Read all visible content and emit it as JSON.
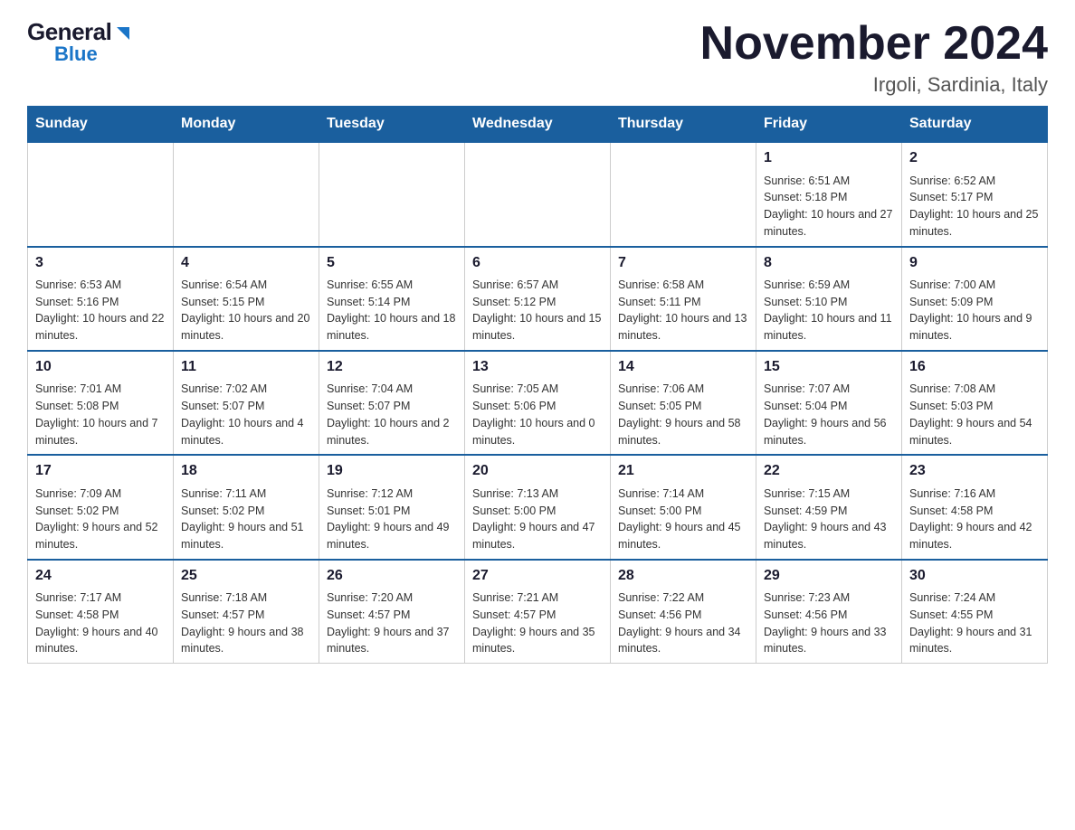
{
  "header": {
    "logo_general": "General",
    "logo_triangle": "▶",
    "logo_blue": "Blue",
    "month_title": "November 2024",
    "location": "Irgoli, Sardinia, Italy"
  },
  "days_of_week": [
    "Sunday",
    "Monday",
    "Tuesday",
    "Wednesday",
    "Thursday",
    "Friday",
    "Saturday"
  ],
  "weeks": [
    {
      "days": [
        {
          "num": "",
          "info": ""
        },
        {
          "num": "",
          "info": ""
        },
        {
          "num": "",
          "info": ""
        },
        {
          "num": "",
          "info": ""
        },
        {
          "num": "",
          "info": ""
        },
        {
          "num": "1",
          "info": "Sunrise: 6:51 AM\nSunset: 5:18 PM\nDaylight: 10 hours and 27 minutes."
        },
        {
          "num": "2",
          "info": "Sunrise: 6:52 AM\nSunset: 5:17 PM\nDaylight: 10 hours and 25 minutes."
        }
      ]
    },
    {
      "days": [
        {
          "num": "3",
          "info": "Sunrise: 6:53 AM\nSunset: 5:16 PM\nDaylight: 10 hours and 22 minutes."
        },
        {
          "num": "4",
          "info": "Sunrise: 6:54 AM\nSunset: 5:15 PM\nDaylight: 10 hours and 20 minutes."
        },
        {
          "num": "5",
          "info": "Sunrise: 6:55 AM\nSunset: 5:14 PM\nDaylight: 10 hours and 18 minutes."
        },
        {
          "num": "6",
          "info": "Sunrise: 6:57 AM\nSunset: 5:12 PM\nDaylight: 10 hours and 15 minutes."
        },
        {
          "num": "7",
          "info": "Sunrise: 6:58 AM\nSunset: 5:11 PM\nDaylight: 10 hours and 13 minutes."
        },
        {
          "num": "8",
          "info": "Sunrise: 6:59 AM\nSunset: 5:10 PM\nDaylight: 10 hours and 11 minutes."
        },
        {
          "num": "9",
          "info": "Sunrise: 7:00 AM\nSunset: 5:09 PM\nDaylight: 10 hours and 9 minutes."
        }
      ]
    },
    {
      "days": [
        {
          "num": "10",
          "info": "Sunrise: 7:01 AM\nSunset: 5:08 PM\nDaylight: 10 hours and 7 minutes."
        },
        {
          "num": "11",
          "info": "Sunrise: 7:02 AM\nSunset: 5:07 PM\nDaylight: 10 hours and 4 minutes."
        },
        {
          "num": "12",
          "info": "Sunrise: 7:04 AM\nSunset: 5:07 PM\nDaylight: 10 hours and 2 minutes."
        },
        {
          "num": "13",
          "info": "Sunrise: 7:05 AM\nSunset: 5:06 PM\nDaylight: 10 hours and 0 minutes."
        },
        {
          "num": "14",
          "info": "Sunrise: 7:06 AM\nSunset: 5:05 PM\nDaylight: 9 hours and 58 minutes."
        },
        {
          "num": "15",
          "info": "Sunrise: 7:07 AM\nSunset: 5:04 PM\nDaylight: 9 hours and 56 minutes."
        },
        {
          "num": "16",
          "info": "Sunrise: 7:08 AM\nSunset: 5:03 PM\nDaylight: 9 hours and 54 minutes."
        }
      ]
    },
    {
      "days": [
        {
          "num": "17",
          "info": "Sunrise: 7:09 AM\nSunset: 5:02 PM\nDaylight: 9 hours and 52 minutes."
        },
        {
          "num": "18",
          "info": "Sunrise: 7:11 AM\nSunset: 5:02 PM\nDaylight: 9 hours and 51 minutes."
        },
        {
          "num": "19",
          "info": "Sunrise: 7:12 AM\nSunset: 5:01 PM\nDaylight: 9 hours and 49 minutes."
        },
        {
          "num": "20",
          "info": "Sunrise: 7:13 AM\nSunset: 5:00 PM\nDaylight: 9 hours and 47 minutes."
        },
        {
          "num": "21",
          "info": "Sunrise: 7:14 AM\nSunset: 5:00 PM\nDaylight: 9 hours and 45 minutes."
        },
        {
          "num": "22",
          "info": "Sunrise: 7:15 AM\nSunset: 4:59 PM\nDaylight: 9 hours and 43 minutes."
        },
        {
          "num": "23",
          "info": "Sunrise: 7:16 AM\nSunset: 4:58 PM\nDaylight: 9 hours and 42 minutes."
        }
      ]
    },
    {
      "days": [
        {
          "num": "24",
          "info": "Sunrise: 7:17 AM\nSunset: 4:58 PM\nDaylight: 9 hours and 40 minutes."
        },
        {
          "num": "25",
          "info": "Sunrise: 7:18 AM\nSunset: 4:57 PM\nDaylight: 9 hours and 38 minutes."
        },
        {
          "num": "26",
          "info": "Sunrise: 7:20 AM\nSunset: 4:57 PM\nDaylight: 9 hours and 37 minutes."
        },
        {
          "num": "27",
          "info": "Sunrise: 7:21 AM\nSunset: 4:57 PM\nDaylight: 9 hours and 35 minutes."
        },
        {
          "num": "28",
          "info": "Sunrise: 7:22 AM\nSunset: 4:56 PM\nDaylight: 9 hours and 34 minutes."
        },
        {
          "num": "29",
          "info": "Sunrise: 7:23 AM\nSunset: 4:56 PM\nDaylight: 9 hours and 33 minutes."
        },
        {
          "num": "30",
          "info": "Sunrise: 7:24 AM\nSunset: 4:55 PM\nDaylight: 9 hours and 31 minutes."
        }
      ]
    }
  ]
}
